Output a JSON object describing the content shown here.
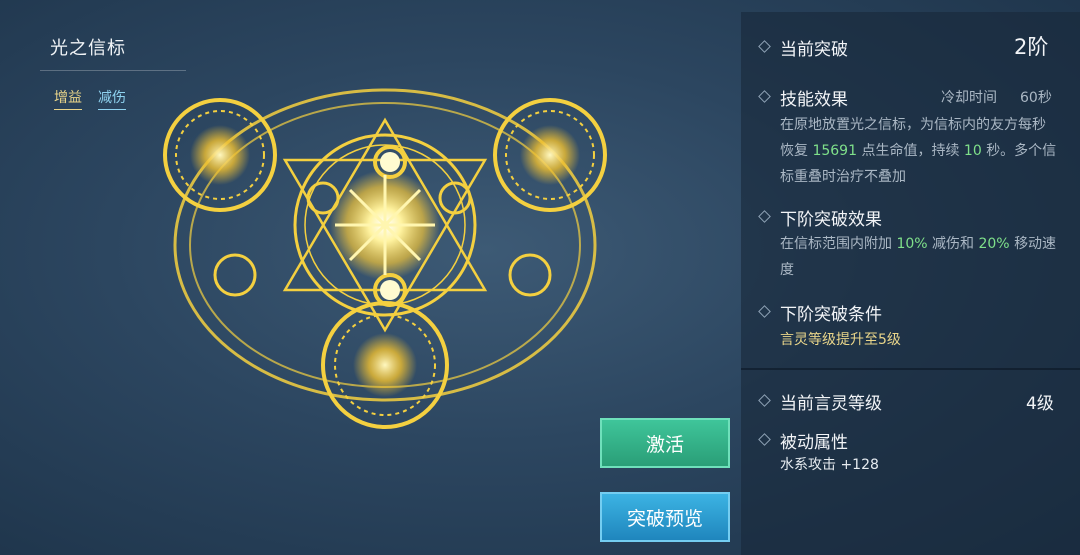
{
  "skill": {
    "name": "光之信标",
    "tags": [
      "增益",
      "减伤"
    ]
  },
  "panel": {
    "current_break_label": "当前突破",
    "current_break_value": "2阶",
    "skill_effect_label": "技能效果",
    "cooldown_label": "冷却时间",
    "cooldown_value": "60秒",
    "effect_text_1": "在原地放置光之信标，为信标内的友方每秒",
    "effect_text_2a": "恢复",
    "effect_heal": "15691",
    "effect_text_2b": "点生命值，持续",
    "effect_duration": "10",
    "effect_text_2c": "秒。多个信",
    "effect_text_3": "标重叠时治疗不叠加",
    "next_effect_label": "下阶突破效果",
    "next_effect_text_1a": "在信标范围内附加",
    "next_effect_dmg": "10%",
    "next_effect_text_1b": "减伤和",
    "next_effect_speed": "20%",
    "next_effect_text_1c": "移动速",
    "next_effect_text_2": "度",
    "next_condition_label": "下阶突破条件",
    "next_condition_text": "言灵等级提升至5级",
    "level_label": "当前言灵等级",
    "level_value": "4级",
    "passive_label": "被动属性",
    "passive_text": "水系攻击 +128"
  },
  "buttons": {
    "activate": "激活",
    "preview": "突破预览"
  },
  "colors": {
    "gold": "#e9d58a",
    "green_highlight": "#7fe08a",
    "activate_button": "#2fae84",
    "preview_button": "#2a9bd2"
  }
}
